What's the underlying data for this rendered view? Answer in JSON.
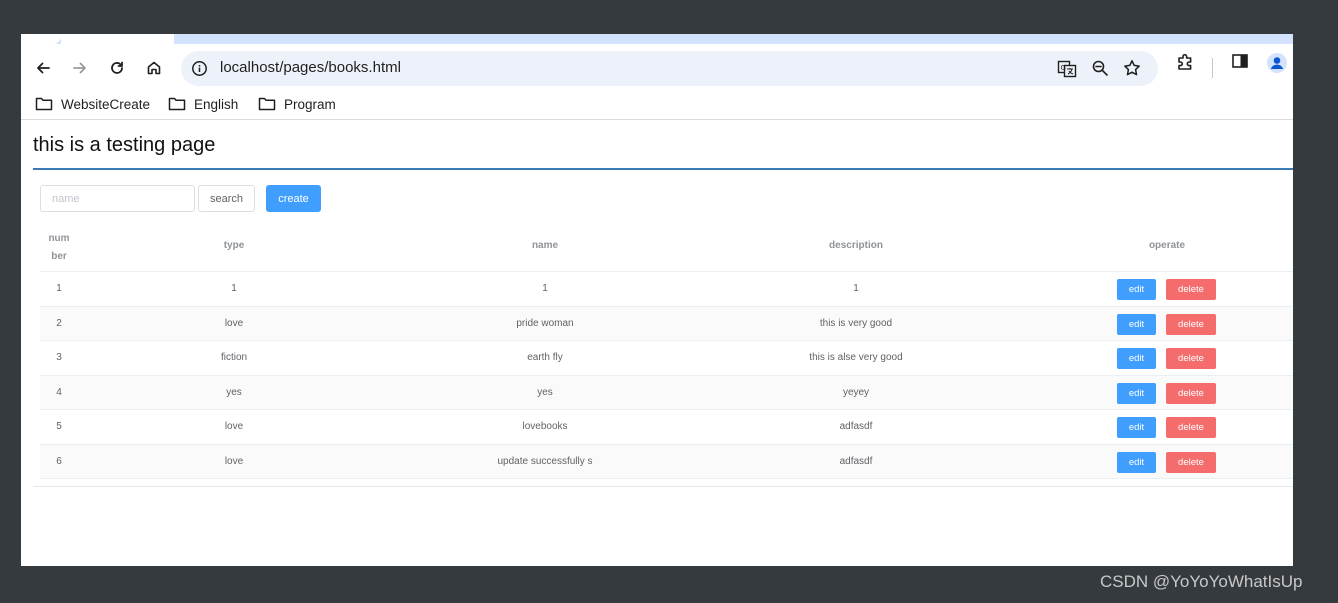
{
  "browser": {
    "url_host": "localhost",
    "url_path": "/pages/books.html",
    "bookmarks": [
      {
        "label": "WebsiteCreate"
      },
      {
        "label": "English"
      },
      {
        "label": "Program"
      }
    ]
  },
  "page": {
    "title": "this is a testing page",
    "search": {
      "placeholder": "name",
      "value": ""
    },
    "search_label": "search",
    "create_label": "create"
  },
  "table": {
    "headers": {
      "number_line1": "num",
      "number_line2": "ber",
      "type": "type",
      "name": "name",
      "description": "description",
      "operate": "operate"
    },
    "rows": [
      {
        "number": "1",
        "type": "1",
        "name": "1",
        "description": "1"
      },
      {
        "number": "2",
        "type": "love",
        "name": "pride woman",
        "description": "this is very good"
      },
      {
        "number": "3",
        "type": "fiction",
        "name": "earth fly",
        "description": "this is alse very good"
      },
      {
        "number": "4",
        "type": "yes",
        "name": "yes",
        "description": "yeyey"
      },
      {
        "number": "5",
        "type": "love",
        "name": "lovebooks",
        "description": "adfasdf"
      },
      {
        "number": "6",
        "type": "love",
        "name": "update successfully s",
        "description": "adfasdf"
      }
    ],
    "edit_label": "edit",
    "delete_label": "delete"
  },
  "watermark": "CSDN @YoYoYoWhatIsUp",
  "colors": {
    "primary": "#409eff",
    "danger": "#f56c6c",
    "title_rule": "#3a7ab5",
    "frame": "#353a3f"
  },
  "icons": [
    "back-arrow-icon",
    "forward-arrow-icon",
    "reload-icon",
    "home-icon",
    "info-icon",
    "translate-icon",
    "zoom-out-icon",
    "star-icon",
    "extensions-icon",
    "side-panel-icon",
    "profile-icon",
    "folder-icon"
  ]
}
